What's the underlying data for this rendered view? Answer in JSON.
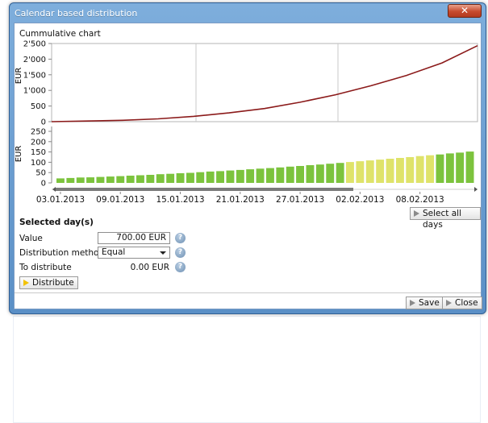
{
  "window": {
    "title": "Calendar based distribution",
    "close_symbol": "✕"
  },
  "cumulative": {
    "title": "Cummulative chart",
    "ylabel": "EUR",
    "y_ticks": [
      "2'500",
      "2'000",
      "1'500",
      "1'000",
      "500",
      "0"
    ]
  },
  "daily": {
    "ylabel": "EUR",
    "y_ticks": [
      "250",
      "200",
      "150",
      "100",
      "50",
      "0"
    ],
    "x_ticks": [
      "03.01.2013",
      "09.01.2013",
      "15.01.2013",
      "21.01.2013",
      "27.01.2013",
      "02.02.2013",
      "08.02.2013"
    ]
  },
  "chart_data": [
    {
      "type": "line",
      "title": "Cummulative chart",
      "ylabel": "EUR",
      "ylim": [
        0,
        2500
      ],
      "x_range": [
        "03.01.2013",
        "15.02.2013"
      ],
      "series": [
        {
          "values": [
            0,
            20,
            45,
            90,
            170,
            280,
            420,
            620,
            860,
            1150,
            1480,
            1880,
            2430
          ]
        }
      ],
      "color": "#8b1a1a",
      "grid": true
    },
    {
      "type": "bar",
      "ylabel": "EUR",
      "ylim": [
        0,
        250
      ],
      "x_tick_labels": [
        "03.01.2013",
        "09.01.2013",
        "15.01.2013",
        "21.01.2013",
        "27.01.2013",
        "02.02.2013",
        "08.02.2013"
      ],
      "values": [
        22,
        24,
        26,
        27,
        29,
        31,
        33,
        35,
        37,
        39,
        42,
        44,
        47,
        49,
        52,
        55,
        57,
        60,
        63,
        66,
        69,
        72,
        75,
        79,
        82,
        86,
        89,
        93,
        97,
        101,
        105,
        109,
        113,
        117,
        121,
        125,
        130,
        134,
        138,
        143,
        147,
        152
      ],
      "highlighted_range": [
        29,
        37
      ],
      "colors": {
        "normal": "#7cc33d",
        "highlighted": "#dfe36a"
      }
    }
  ],
  "buttons": {
    "select_all": "Select all days",
    "distribute": "Distribute",
    "save": "Save",
    "close": "Close"
  },
  "form": {
    "section_title": "Selected day(s)",
    "value_label": "Value",
    "value": "700.00 EUR",
    "method_label": "Distribution method",
    "method_value": "Equal",
    "to_distribute_label": "To distribute",
    "to_distribute_value": "0.00 EUR",
    "help_symbol": "?"
  }
}
